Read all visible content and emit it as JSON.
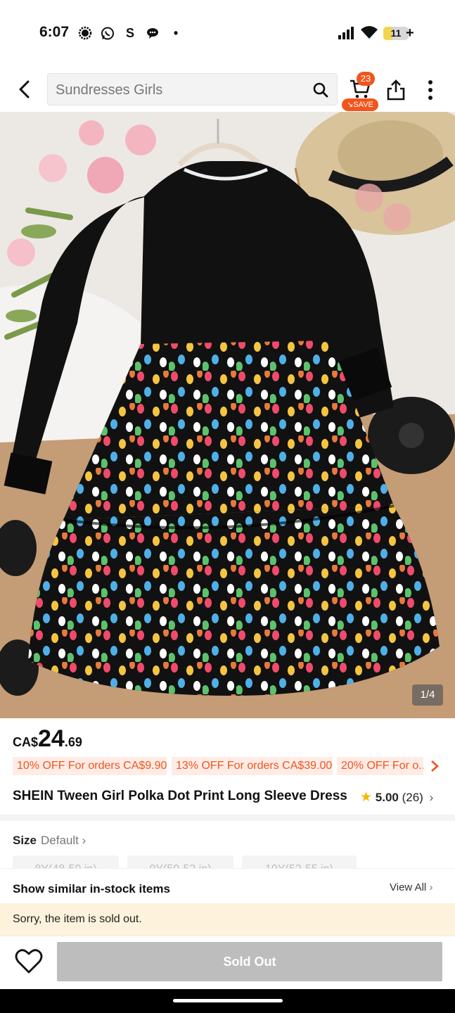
{
  "status_bar": {
    "time": "6:07",
    "notification_icons": [
      "signal-app-icon",
      "whatsapp-icon",
      "s-app-icon",
      "chat-bubble-icon",
      "dot-icon"
    ],
    "s_glyph": "S",
    "dot_glyph": "•",
    "battery_level": "11",
    "battery_fraction": 0.11,
    "charging_glyph": "+"
  },
  "header": {
    "search_placeholder": "Sundresses Girls",
    "cart_count": "23",
    "save_label": "SAVE"
  },
  "gallery": {
    "counter": "1/4",
    "current_index": 1,
    "total": 4
  },
  "price": {
    "currency": "CA$",
    "integer": "24",
    "decimal": ".69"
  },
  "coupons": [
    "10% OFF For orders CA$9.90+",
    "13% OFF For orders CA$39.00+",
    "20% OFF For o..."
  ],
  "product": {
    "title": "SHEIN Tween Girl Polka Dot Print Long Sleeve Dress",
    "rating": "5.00",
    "review_count": "(26)"
  },
  "size": {
    "label": "Size",
    "value": "Default",
    "chips": [
      "8Y(48-50 in)",
      "9Y(50-52 in)",
      "10Y(52-55 in)"
    ]
  },
  "similar": {
    "label": "Show similar in-stock items",
    "view_all": "View All"
  },
  "notice": "Sorry, the item is sold out.",
  "actions": {
    "sold_out_label": "Sold Out"
  },
  "colors": {
    "accent": "#f2541b",
    "star": "#f6b500",
    "sold_out_button": "#bdbdbd",
    "notice_bg": "#fdf2dc"
  }
}
